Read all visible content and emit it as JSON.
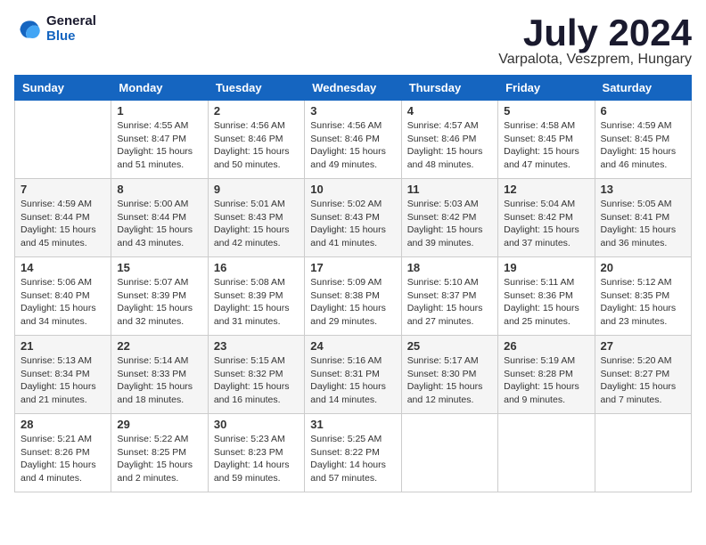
{
  "logo": {
    "text_general": "General",
    "text_blue": "Blue"
  },
  "header": {
    "month": "July 2024",
    "subtitle": "Varpalota, Veszprem, Hungary"
  },
  "weekdays": [
    "Sunday",
    "Monday",
    "Tuesday",
    "Wednesday",
    "Thursday",
    "Friday",
    "Saturday"
  ],
  "weeks": [
    [
      {
        "day": "",
        "info": ""
      },
      {
        "day": "1",
        "info": "Sunrise: 4:55 AM\nSunset: 8:47 PM\nDaylight: 15 hours\nand 51 minutes."
      },
      {
        "day": "2",
        "info": "Sunrise: 4:56 AM\nSunset: 8:46 PM\nDaylight: 15 hours\nand 50 minutes."
      },
      {
        "day": "3",
        "info": "Sunrise: 4:56 AM\nSunset: 8:46 PM\nDaylight: 15 hours\nand 49 minutes."
      },
      {
        "day": "4",
        "info": "Sunrise: 4:57 AM\nSunset: 8:46 PM\nDaylight: 15 hours\nand 48 minutes."
      },
      {
        "day": "5",
        "info": "Sunrise: 4:58 AM\nSunset: 8:45 PM\nDaylight: 15 hours\nand 47 minutes."
      },
      {
        "day": "6",
        "info": "Sunrise: 4:59 AM\nSunset: 8:45 PM\nDaylight: 15 hours\nand 46 minutes."
      }
    ],
    [
      {
        "day": "7",
        "info": "Sunrise: 4:59 AM\nSunset: 8:44 PM\nDaylight: 15 hours\nand 45 minutes."
      },
      {
        "day": "8",
        "info": "Sunrise: 5:00 AM\nSunset: 8:44 PM\nDaylight: 15 hours\nand 43 minutes."
      },
      {
        "day": "9",
        "info": "Sunrise: 5:01 AM\nSunset: 8:43 PM\nDaylight: 15 hours\nand 42 minutes."
      },
      {
        "day": "10",
        "info": "Sunrise: 5:02 AM\nSunset: 8:43 PM\nDaylight: 15 hours\nand 41 minutes."
      },
      {
        "day": "11",
        "info": "Sunrise: 5:03 AM\nSunset: 8:42 PM\nDaylight: 15 hours\nand 39 minutes."
      },
      {
        "day": "12",
        "info": "Sunrise: 5:04 AM\nSunset: 8:42 PM\nDaylight: 15 hours\nand 37 minutes."
      },
      {
        "day": "13",
        "info": "Sunrise: 5:05 AM\nSunset: 8:41 PM\nDaylight: 15 hours\nand 36 minutes."
      }
    ],
    [
      {
        "day": "14",
        "info": "Sunrise: 5:06 AM\nSunset: 8:40 PM\nDaylight: 15 hours\nand 34 minutes."
      },
      {
        "day": "15",
        "info": "Sunrise: 5:07 AM\nSunset: 8:39 PM\nDaylight: 15 hours\nand 32 minutes."
      },
      {
        "day": "16",
        "info": "Sunrise: 5:08 AM\nSunset: 8:39 PM\nDaylight: 15 hours\nand 31 minutes."
      },
      {
        "day": "17",
        "info": "Sunrise: 5:09 AM\nSunset: 8:38 PM\nDaylight: 15 hours\nand 29 minutes."
      },
      {
        "day": "18",
        "info": "Sunrise: 5:10 AM\nSunset: 8:37 PM\nDaylight: 15 hours\nand 27 minutes."
      },
      {
        "day": "19",
        "info": "Sunrise: 5:11 AM\nSunset: 8:36 PM\nDaylight: 15 hours\nand 25 minutes."
      },
      {
        "day": "20",
        "info": "Sunrise: 5:12 AM\nSunset: 8:35 PM\nDaylight: 15 hours\nand 23 minutes."
      }
    ],
    [
      {
        "day": "21",
        "info": "Sunrise: 5:13 AM\nSunset: 8:34 PM\nDaylight: 15 hours\nand 21 minutes."
      },
      {
        "day": "22",
        "info": "Sunrise: 5:14 AM\nSunset: 8:33 PM\nDaylight: 15 hours\nand 18 minutes."
      },
      {
        "day": "23",
        "info": "Sunrise: 5:15 AM\nSunset: 8:32 PM\nDaylight: 15 hours\nand 16 minutes."
      },
      {
        "day": "24",
        "info": "Sunrise: 5:16 AM\nSunset: 8:31 PM\nDaylight: 15 hours\nand 14 minutes."
      },
      {
        "day": "25",
        "info": "Sunrise: 5:17 AM\nSunset: 8:30 PM\nDaylight: 15 hours\nand 12 minutes."
      },
      {
        "day": "26",
        "info": "Sunrise: 5:19 AM\nSunset: 8:28 PM\nDaylight: 15 hours\nand 9 minutes."
      },
      {
        "day": "27",
        "info": "Sunrise: 5:20 AM\nSunset: 8:27 PM\nDaylight: 15 hours\nand 7 minutes."
      }
    ],
    [
      {
        "day": "28",
        "info": "Sunrise: 5:21 AM\nSunset: 8:26 PM\nDaylight: 15 hours\nand 4 minutes."
      },
      {
        "day": "29",
        "info": "Sunrise: 5:22 AM\nSunset: 8:25 PM\nDaylight: 15 hours\nand 2 minutes."
      },
      {
        "day": "30",
        "info": "Sunrise: 5:23 AM\nSunset: 8:23 PM\nDaylight: 14 hours\nand 59 minutes."
      },
      {
        "day": "31",
        "info": "Sunrise: 5:25 AM\nSunset: 8:22 PM\nDaylight: 14 hours\nand 57 minutes."
      },
      {
        "day": "",
        "info": ""
      },
      {
        "day": "",
        "info": ""
      },
      {
        "day": "",
        "info": ""
      }
    ]
  ]
}
